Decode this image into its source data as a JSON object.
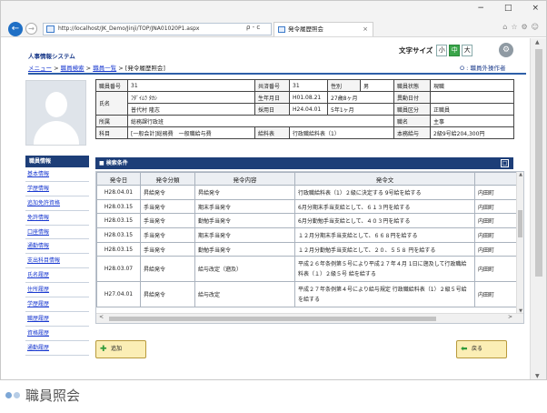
{
  "browser": {
    "url": "http://localhost/JK_Demo/Jinji/TOP/JNA01020P1.aspx",
    "address_buttons": "ρ - c",
    "tab_title": "発令履歴照会",
    "tab_close": "×",
    "window_controls": [
      "−",
      "□",
      "×"
    ],
    "toolbar_icons": [
      "⌂",
      "☆",
      "⚙",
      "☺"
    ],
    "back_arrow": "←",
    "forward_arrow": "→"
  },
  "app": {
    "system_name": "人事情報システム",
    "breadcrumb": {
      "menu": "メニュー",
      "sep1": " > ",
      "search": "職員検索",
      "sep2": " > ",
      "list": "職員一覧",
      "sep3": " > ",
      "current": "[発令履歴照会]"
    },
    "fontsize": {
      "label": "文字サイズ",
      "small": "小",
      "medium": "中",
      "large": "大"
    },
    "operator": "O : 職員外操作者"
  },
  "profile": {
    "labels": {
      "staff_no": "職員番号",
      "kyosai_no": "共済番号",
      "gender": "性別",
      "status": "職員状態",
      "name": "氏名",
      "birth": "生年月日",
      "retire": "異動日付",
      "hire": "採用日",
      "category": "職員区分",
      "dept": "所属",
      "post": "職名",
      "subject": "科目",
      "salary_table": "給料表",
      "current_salary": "本務給与"
    },
    "values": {
      "staff_no": "31",
      "kyosai_no": "31",
      "gender": "男",
      "status": "現職",
      "kana": "ﾌﾀﾞｲﾑﾗ ﾀｶｼ",
      "kanji": "普代村 隆志",
      "birth": "H01.08.21",
      "age": "27歳8ヶ月",
      "retire": "",
      "hire": "H24.04.01",
      "tenure": "5年1ヶ月",
      "category": "正職員",
      "dept": "総務課行政班",
      "post": "主事",
      "subject": "[一般会計]総務費　一般職給与費",
      "salary_table": "行政職給料表（1）",
      "current_salary": "2級9号給204,300円"
    }
  },
  "sidemenu": {
    "title": "職員情報",
    "items": [
      "基本情報",
      "学歴情報",
      "追加免許資格",
      "免許情報",
      "口座情報",
      "通勤情報",
      "支出科目情報",
      "氏名履歴",
      "住所履歴",
      "学歴履歴",
      "職歴履歴",
      "資格履歴",
      "通勤履歴"
    ]
  },
  "panel": {
    "title": "■ 検索条件",
    "toggle": "□"
  },
  "grid": {
    "headers": [
      "発令日",
      "発令分類",
      "発令内容",
      "発令文",
      ""
    ],
    "rows": [
      {
        "date": "H28.04.01",
        "cls": "昇給発令",
        "content": "昇給発令",
        "text": "行政職給料表（1）２級に決定する 9号給を給する",
        "extra": "内田町"
      },
      {
        "date": "H28.03.15",
        "cls": "手当発令",
        "content": "期末手当発令",
        "text": "6月分期末手当支給として、６１３円を給する",
        "extra": "内田町"
      },
      {
        "date": "H28.03.15",
        "cls": "手当発令",
        "content": "勤勉手当発令",
        "text": "6月分勤勉手当支給として、４０３円を給する",
        "extra": "内田町"
      },
      {
        "date": "H28.03.15",
        "cls": "手当発令",
        "content": "期末手当発令",
        "text": "１２月分期末手当支給として、６６８円を給する",
        "extra": "内田町"
      },
      {
        "date": "H28.03.15",
        "cls": "手当発令",
        "content": "勤勉手当発令",
        "text": "１２月分勤勉手当支給として、２０、５５８ 円を給する",
        "extra": "内田町"
      },
      {
        "date": "H28.03.07",
        "cls": "昇給発令",
        "content": "給与改定（遡及）",
        "text": "平成２６年条例第５号により平成２７年４月 1日に遡及して行政職給料表（１）２級５号 給を給する",
        "extra": "内田町"
      },
      {
        "date": "H27.04.01",
        "cls": "昇給発令",
        "content": "給与改定",
        "text": "平成２７年条例第４号により給与規定 行政職給料表（1）２級５号給を給する",
        "extra": "内田町"
      }
    ]
  },
  "buttons": {
    "add_label": "追加",
    "add_icon": "✚",
    "back_label": "戻る",
    "back_icon": "⬅"
  },
  "caption": {
    "text": "職員照会",
    "dot_colors": [
      "#7da7d6",
      "#b7cde6"
    ]
  }
}
